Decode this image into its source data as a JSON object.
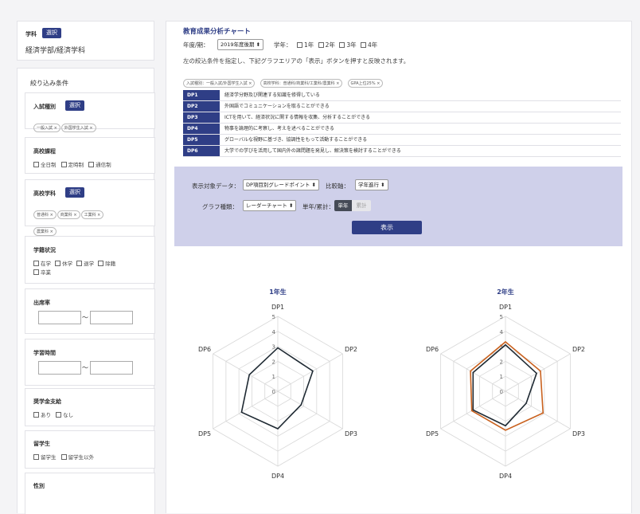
{
  "dept": {
    "label": "学科",
    "select_label": "選択",
    "value": "経済学部/経済学科"
  },
  "filter": {
    "title": "絞り込み条件",
    "entrance": {
      "title": "入試種別",
      "select_label": "選択",
      "tags": [
        "一般入試 ×",
        "外国学生入試 ×"
      ]
    },
    "hs_course": {
      "title": "高校課程",
      "options": [
        "全日制",
        "定時制",
        "通信制"
      ]
    },
    "hs_subject": {
      "title": "高校学科",
      "select_label": "選択",
      "tags": [
        "普通科 ×",
        "商業科 ×",
        "工業科 ×",
        "農業科 ×"
      ]
    },
    "enrollment": {
      "title": "学籍状況",
      "options": [
        "在学",
        "休学",
        "退学",
        "除籍",
        "卒業"
      ]
    },
    "attendance": {
      "title": "出席率",
      "tilde": "〜"
    },
    "study_time": {
      "title": "学習時間",
      "tilde": "〜"
    },
    "scholarship": {
      "title": "奨学金支給",
      "options": [
        "あり",
        "なし"
      ]
    },
    "intl": {
      "title": "留学生",
      "options": [
        "留学生",
        "留学生以外"
      ]
    },
    "gender": {
      "title": "性別"
    }
  },
  "main": {
    "title": "教育成果分析チャート",
    "year_label": "年度/期：",
    "year_value": "2019年度後期 ⬍",
    "grade_label": "学年：",
    "grades": [
      "1年",
      "2年",
      "3年",
      "4年"
    ],
    "instruction": "左の絞込条件を指定し、下記グラフエリアの「表示」ボタンを押すと反映されます。",
    "chips": [
      "入試種別：一般入試/外国学生入試 ×",
      "高校学科：普通科/商業科/工業科/農業科 ×",
      "GPA上位25% ×"
    ]
  },
  "dp_rows": [
    {
      "code": "DP1",
      "text": "経済学分野及び関連する知識を修得している"
    },
    {
      "code": "DP2",
      "text": "外国語でコミュニケーションを取ることができる"
    },
    {
      "code": "DP3",
      "text": "ICTを用いて、経済状況に関する情報を収集、分析することができる"
    },
    {
      "code": "DP4",
      "text": "物事を論理的に考察し、考えを述べることができる"
    },
    {
      "code": "DP5",
      "text": "グローバルな視野に基づき、協調性をもって活動することができる"
    },
    {
      "code": "DP6",
      "text": "大学での学びを活用して国内外の諸問題を発見し、解決策を検討することができる"
    }
  ],
  "controls": {
    "data_label": "表示対象データ：",
    "data_value": "DP項目別グレードポイント ⬍",
    "axis_label": "比較軸：",
    "axis_value": "学年進行 ⬍",
    "type_label": "グラフ種類：",
    "type_value": "レーダーチャート ⬍",
    "mode_label": "単年/累計：",
    "mode_options": [
      "単年",
      "累計"
    ],
    "show_button": "表示"
  },
  "colors": {
    "accent": "#2f3e86",
    "series_a": "#1f2a33",
    "series_b": "#c9611e",
    "controls_bg": "#cfd0ea"
  },
  "chart_data": [
    {
      "type": "radar",
      "title": "1年生",
      "axes": [
        "DP1",
        "DP2",
        "DP3",
        "DP4",
        "DP5",
        "DP6"
      ],
      "ticks": [
        "0",
        "1",
        "2",
        "3",
        "4",
        "5"
      ],
      "range": [
        0,
        5
      ],
      "series": [
        {
          "values": [
            2.9,
            2.7,
            1.8,
            2.5,
            2.8,
            2.2
          ],
          "color": "#1f2a33"
        }
      ]
    },
    {
      "type": "radar",
      "title": "2年生",
      "axes": [
        "DP1",
        "DP2",
        "DP3",
        "DP4",
        "DP5",
        "DP6"
      ],
      "ticks": [
        "0",
        "1",
        "2",
        "3",
        "4",
        "5"
      ],
      "range": [
        0,
        5
      ],
      "series": [
        {
          "values": [
            3.3,
            2.7,
            2.9,
            2.6,
            2.6,
            2.7
          ],
          "color": "#c9611e"
        },
        {
          "values": [
            3.1,
            2.4,
            1.6,
            2.3,
            2.5,
            2.5
          ],
          "color": "#1f2a33"
        }
      ]
    }
  ]
}
